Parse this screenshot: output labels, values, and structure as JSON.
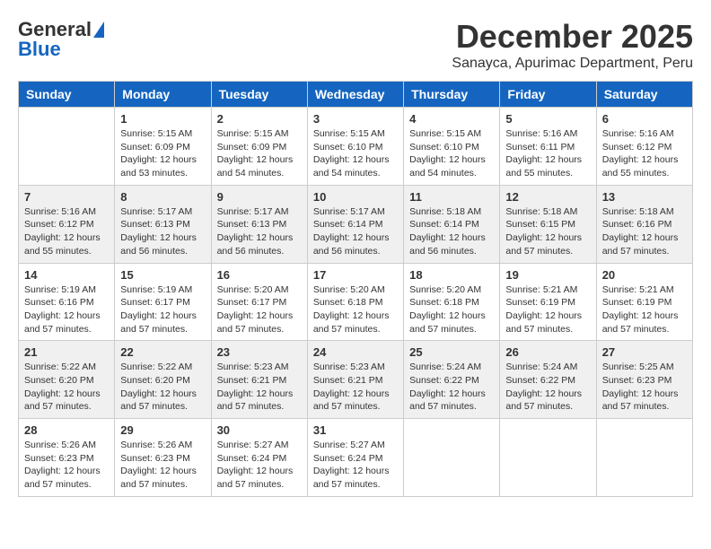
{
  "logo": {
    "line1": "General",
    "line2": "Blue"
  },
  "title": "December 2025",
  "subtitle": "Sanayca, Apurimac Department, Peru",
  "days_of_week": [
    "Sunday",
    "Monday",
    "Tuesday",
    "Wednesday",
    "Thursday",
    "Friday",
    "Saturday"
  ],
  "weeks": [
    [
      {
        "day": "",
        "content": ""
      },
      {
        "day": "1",
        "content": "Sunrise: 5:15 AM\nSunset: 6:09 PM\nDaylight: 12 hours\nand 53 minutes."
      },
      {
        "day": "2",
        "content": "Sunrise: 5:15 AM\nSunset: 6:09 PM\nDaylight: 12 hours\nand 54 minutes."
      },
      {
        "day": "3",
        "content": "Sunrise: 5:15 AM\nSunset: 6:10 PM\nDaylight: 12 hours\nand 54 minutes."
      },
      {
        "day": "4",
        "content": "Sunrise: 5:15 AM\nSunset: 6:10 PM\nDaylight: 12 hours\nand 54 minutes."
      },
      {
        "day": "5",
        "content": "Sunrise: 5:16 AM\nSunset: 6:11 PM\nDaylight: 12 hours\nand 55 minutes."
      },
      {
        "day": "6",
        "content": "Sunrise: 5:16 AM\nSunset: 6:12 PM\nDaylight: 12 hours\nand 55 minutes."
      }
    ],
    [
      {
        "day": "7",
        "content": "Sunrise: 5:16 AM\nSunset: 6:12 PM\nDaylight: 12 hours\nand 55 minutes."
      },
      {
        "day": "8",
        "content": "Sunrise: 5:17 AM\nSunset: 6:13 PM\nDaylight: 12 hours\nand 56 minutes."
      },
      {
        "day": "9",
        "content": "Sunrise: 5:17 AM\nSunset: 6:13 PM\nDaylight: 12 hours\nand 56 minutes."
      },
      {
        "day": "10",
        "content": "Sunrise: 5:17 AM\nSunset: 6:14 PM\nDaylight: 12 hours\nand 56 minutes."
      },
      {
        "day": "11",
        "content": "Sunrise: 5:18 AM\nSunset: 6:14 PM\nDaylight: 12 hours\nand 56 minutes."
      },
      {
        "day": "12",
        "content": "Sunrise: 5:18 AM\nSunset: 6:15 PM\nDaylight: 12 hours\nand 57 minutes."
      },
      {
        "day": "13",
        "content": "Sunrise: 5:18 AM\nSunset: 6:16 PM\nDaylight: 12 hours\nand 57 minutes."
      }
    ],
    [
      {
        "day": "14",
        "content": "Sunrise: 5:19 AM\nSunset: 6:16 PM\nDaylight: 12 hours\nand 57 minutes."
      },
      {
        "day": "15",
        "content": "Sunrise: 5:19 AM\nSunset: 6:17 PM\nDaylight: 12 hours\nand 57 minutes."
      },
      {
        "day": "16",
        "content": "Sunrise: 5:20 AM\nSunset: 6:17 PM\nDaylight: 12 hours\nand 57 minutes."
      },
      {
        "day": "17",
        "content": "Sunrise: 5:20 AM\nSunset: 6:18 PM\nDaylight: 12 hours\nand 57 minutes."
      },
      {
        "day": "18",
        "content": "Sunrise: 5:20 AM\nSunset: 6:18 PM\nDaylight: 12 hours\nand 57 minutes."
      },
      {
        "day": "19",
        "content": "Sunrise: 5:21 AM\nSunset: 6:19 PM\nDaylight: 12 hours\nand 57 minutes."
      },
      {
        "day": "20",
        "content": "Sunrise: 5:21 AM\nSunset: 6:19 PM\nDaylight: 12 hours\nand 57 minutes."
      }
    ],
    [
      {
        "day": "21",
        "content": "Sunrise: 5:22 AM\nSunset: 6:20 PM\nDaylight: 12 hours\nand 57 minutes."
      },
      {
        "day": "22",
        "content": "Sunrise: 5:22 AM\nSunset: 6:20 PM\nDaylight: 12 hours\nand 57 minutes."
      },
      {
        "day": "23",
        "content": "Sunrise: 5:23 AM\nSunset: 6:21 PM\nDaylight: 12 hours\nand 57 minutes."
      },
      {
        "day": "24",
        "content": "Sunrise: 5:23 AM\nSunset: 6:21 PM\nDaylight: 12 hours\nand 57 minutes."
      },
      {
        "day": "25",
        "content": "Sunrise: 5:24 AM\nSunset: 6:22 PM\nDaylight: 12 hours\nand 57 minutes."
      },
      {
        "day": "26",
        "content": "Sunrise: 5:24 AM\nSunset: 6:22 PM\nDaylight: 12 hours\nand 57 minutes."
      },
      {
        "day": "27",
        "content": "Sunrise: 5:25 AM\nSunset: 6:23 PM\nDaylight: 12 hours\nand 57 minutes."
      }
    ],
    [
      {
        "day": "28",
        "content": "Sunrise: 5:26 AM\nSunset: 6:23 PM\nDaylight: 12 hours\nand 57 minutes."
      },
      {
        "day": "29",
        "content": "Sunrise: 5:26 AM\nSunset: 6:23 PM\nDaylight: 12 hours\nand 57 minutes."
      },
      {
        "day": "30",
        "content": "Sunrise: 5:27 AM\nSunset: 6:24 PM\nDaylight: 12 hours\nand 57 minutes."
      },
      {
        "day": "31",
        "content": "Sunrise: 5:27 AM\nSunset: 6:24 PM\nDaylight: 12 hours\nand 57 minutes."
      },
      {
        "day": "",
        "content": ""
      },
      {
        "day": "",
        "content": ""
      },
      {
        "day": "",
        "content": ""
      }
    ]
  ]
}
